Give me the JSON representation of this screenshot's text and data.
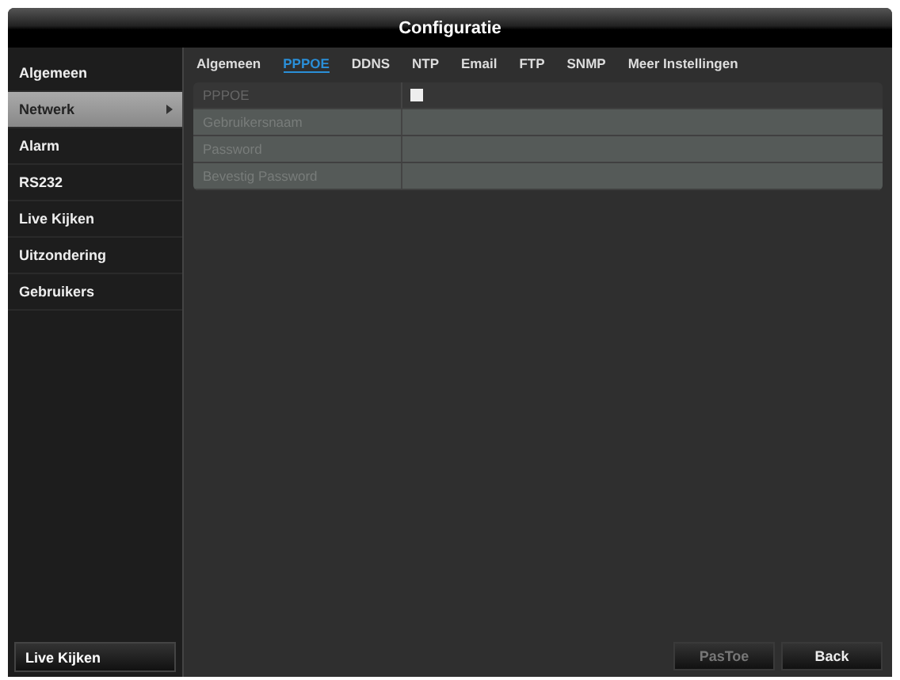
{
  "window": {
    "title": "Configuratie"
  },
  "sidebar": {
    "items": [
      {
        "label": "Algemeen",
        "selected": false,
        "arrow": false
      },
      {
        "label": "Netwerk",
        "selected": true,
        "arrow": true
      },
      {
        "label": "Alarm",
        "selected": false,
        "arrow": false
      },
      {
        "label": "RS232",
        "selected": false,
        "arrow": false
      },
      {
        "label": "Live Kijken",
        "selected": false,
        "arrow": false
      },
      {
        "label": "Uitzondering",
        "selected": false,
        "arrow": false
      },
      {
        "label": "Gebruikers",
        "selected": false,
        "arrow": false
      }
    ],
    "bottom_button": "Live Kijken"
  },
  "tabs": [
    {
      "label": "Algemeen",
      "selected": false
    },
    {
      "label": "PPPOE",
      "selected": true
    },
    {
      "label": "DDNS",
      "selected": false
    },
    {
      "label": "NTP",
      "selected": false
    },
    {
      "label": "Email",
      "selected": false
    },
    {
      "label": "FTP",
      "selected": false
    },
    {
      "label": "SNMP",
      "selected": false
    },
    {
      "label": "Meer Instellingen",
      "selected": false
    }
  ],
  "form": [
    {
      "label": "PPPOE",
      "kind": "checkbox",
      "checked": false,
      "disabled": false
    },
    {
      "label": "Gebruikersnaam",
      "kind": "text",
      "disabled": true
    },
    {
      "label": "Password",
      "kind": "text",
      "disabled": true
    },
    {
      "label": "Bevestig Password",
      "kind": "text",
      "disabled": true
    }
  ],
  "buttons": [
    {
      "label": "PasToe",
      "disabled": true
    },
    {
      "label": "Back",
      "disabled": false
    }
  ]
}
